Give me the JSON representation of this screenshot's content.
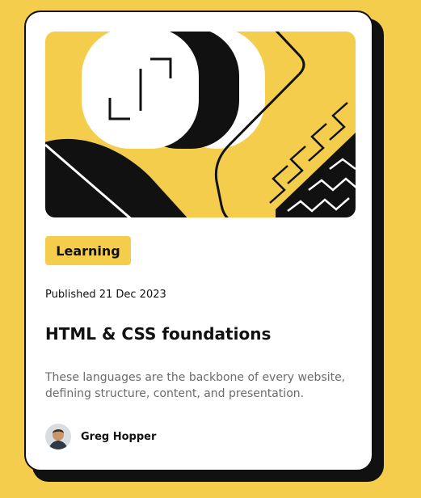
{
  "card": {
    "category": "Learning",
    "published": "Published 21 Dec 2023",
    "title": "HTML & CSS foundations",
    "description": "These languages are the backbone of every website, defining structure, content, and presentation.",
    "author": {
      "name": "Greg Hopper",
      "avatar_icon": "avatar-photo"
    }
  },
  "colors": {
    "page_background": "#f4cd4c",
    "card_background": "#ffffff",
    "ink": "#111111",
    "muted_text": "#6b6b6b",
    "badge_background": "#f4cd4c"
  }
}
